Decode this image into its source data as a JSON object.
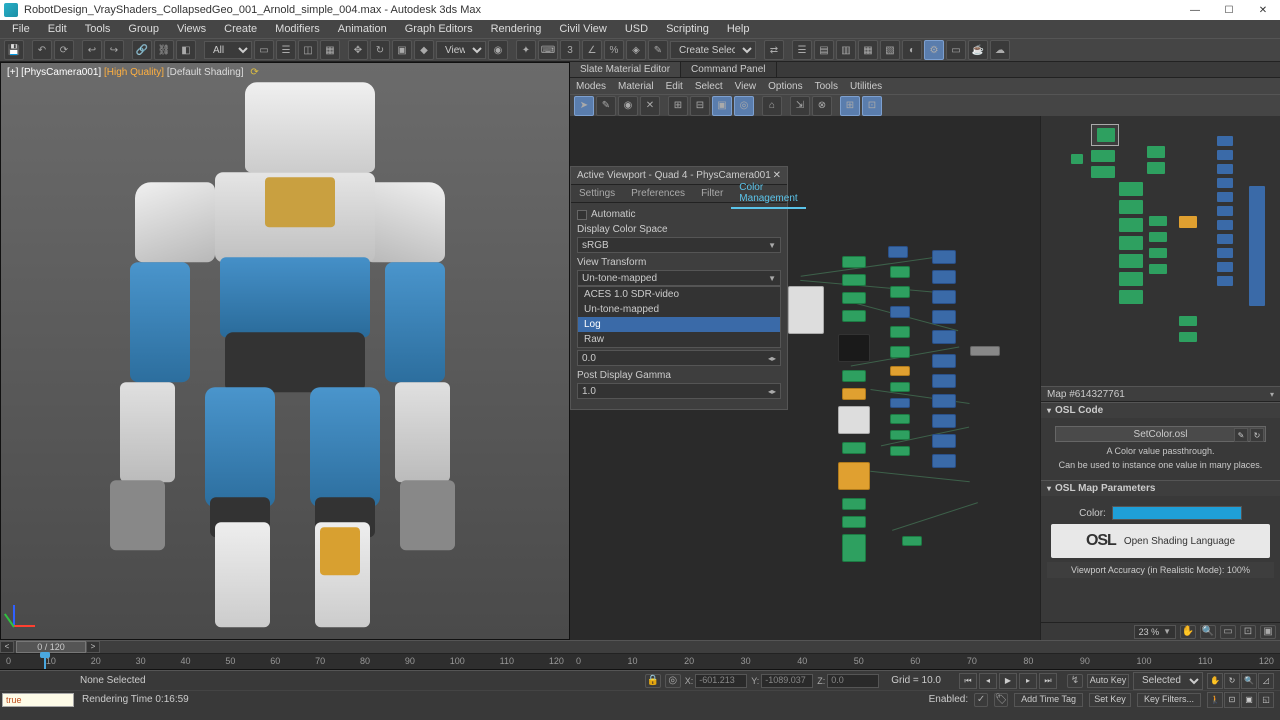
{
  "titlebar": {
    "filename": "RobotDesign_VrayShaders_CollapsedGeo_001_Arnold_simple_004.max - Autodesk 3ds Max"
  },
  "menu": [
    "File",
    "Edit",
    "Tools",
    "Group",
    "Views",
    "Create",
    "Modifiers",
    "Animation",
    "Graph Editors",
    "Rendering",
    "Civil View",
    "USD",
    "Scripting",
    "Help"
  ],
  "toolbar": {
    "sel_filter": "All",
    "view_label": "View",
    "create_sel": "Create Selection Se"
  },
  "viewport": {
    "camera": "[+] [PhysCamera001]",
    "quality": "[High Quality]",
    "shading": "[Default Shading]"
  },
  "subtabs": [
    "Slate Material Editor",
    "Command Panel"
  ],
  "sme_menu": [
    "Modes",
    "Material",
    "Edit",
    "Select",
    "View",
    "Options",
    "Tools",
    "Utilities"
  ],
  "dialog": {
    "title": "Active Viewport - Quad 4 - PhysCamera001",
    "tabs": [
      "Settings",
      "Preferences",
      "Filter",
      "Color Management"
    ],
    "automatic": "Automatic",
    "dcs_label": "Display Color Space",
    "dcs_value": "sRGB",
    "vt_label": "View Transform",
    "vt_value": "Un-tone-mapped",
    "vt_options": [
      "ACES 1.0 SDR-video",
      "Un-tone-mapped",
      "Log",
      "Raw"
    ],
    "exposure_value": "0.0",
    "pdg_label": "Post Display Gamma",
    "pdg_value": "1.0"
  },
  "navigator": {
    "map_title": "Map #614327761",
    "osl_code": "OSL Code",
    "setcolor": "SetColor.osl",
    "desc1": "A Color value passthrough.",
    "desc2": "Can be used to instance one value in many places.",
    "osl_params": "OSL Map Parameters",
    "color_label": "Color:",
    "osl_brand": "OSL",
    "osl_full": "Open Shading Language",
    "vp_acc": "Viewport Accuracy (in Realistic Mode): 100%",
    "zoom": "23 %"
  },
  "timeline": {
    "frame_display": "0 / 120",
    "ticks_l": [
      "0",
      "10",
      "20",
      "30",
      "40",
      "50",
      "60",
      "70",
      "80",
      "90",
      "100",
      "110",
      "120"
    ],
    "ticks_r": [
      "0",
      "10",
      "20",
      "30",
      "40",
      "50",
      "60",
      "70",
      "80",
      "90",
      "100",
      "110",
      "120"
    ]
  },
  "status": {
    "none_selected": "None Selected",
    "enabled": "Enabled:",
    "x_label": "X:",
    "x_val": "-601.213",
    "y_label": "Y:",
    "y_val": "-1089.037",
    "z_label": "Z:",
    "z_val": "0.0",
    "grid": "Grid = 10.0",
    "autokey": "Auto Key",
    "selected": "Selected",
    "mxs": "true",
    "render_time": "Rendering Time  0:16:59",
    "setkey": "Set Key",
    "keyfilters": "Key Filters...",
    "addtimetag": "Add Time Tag"
  }
}
